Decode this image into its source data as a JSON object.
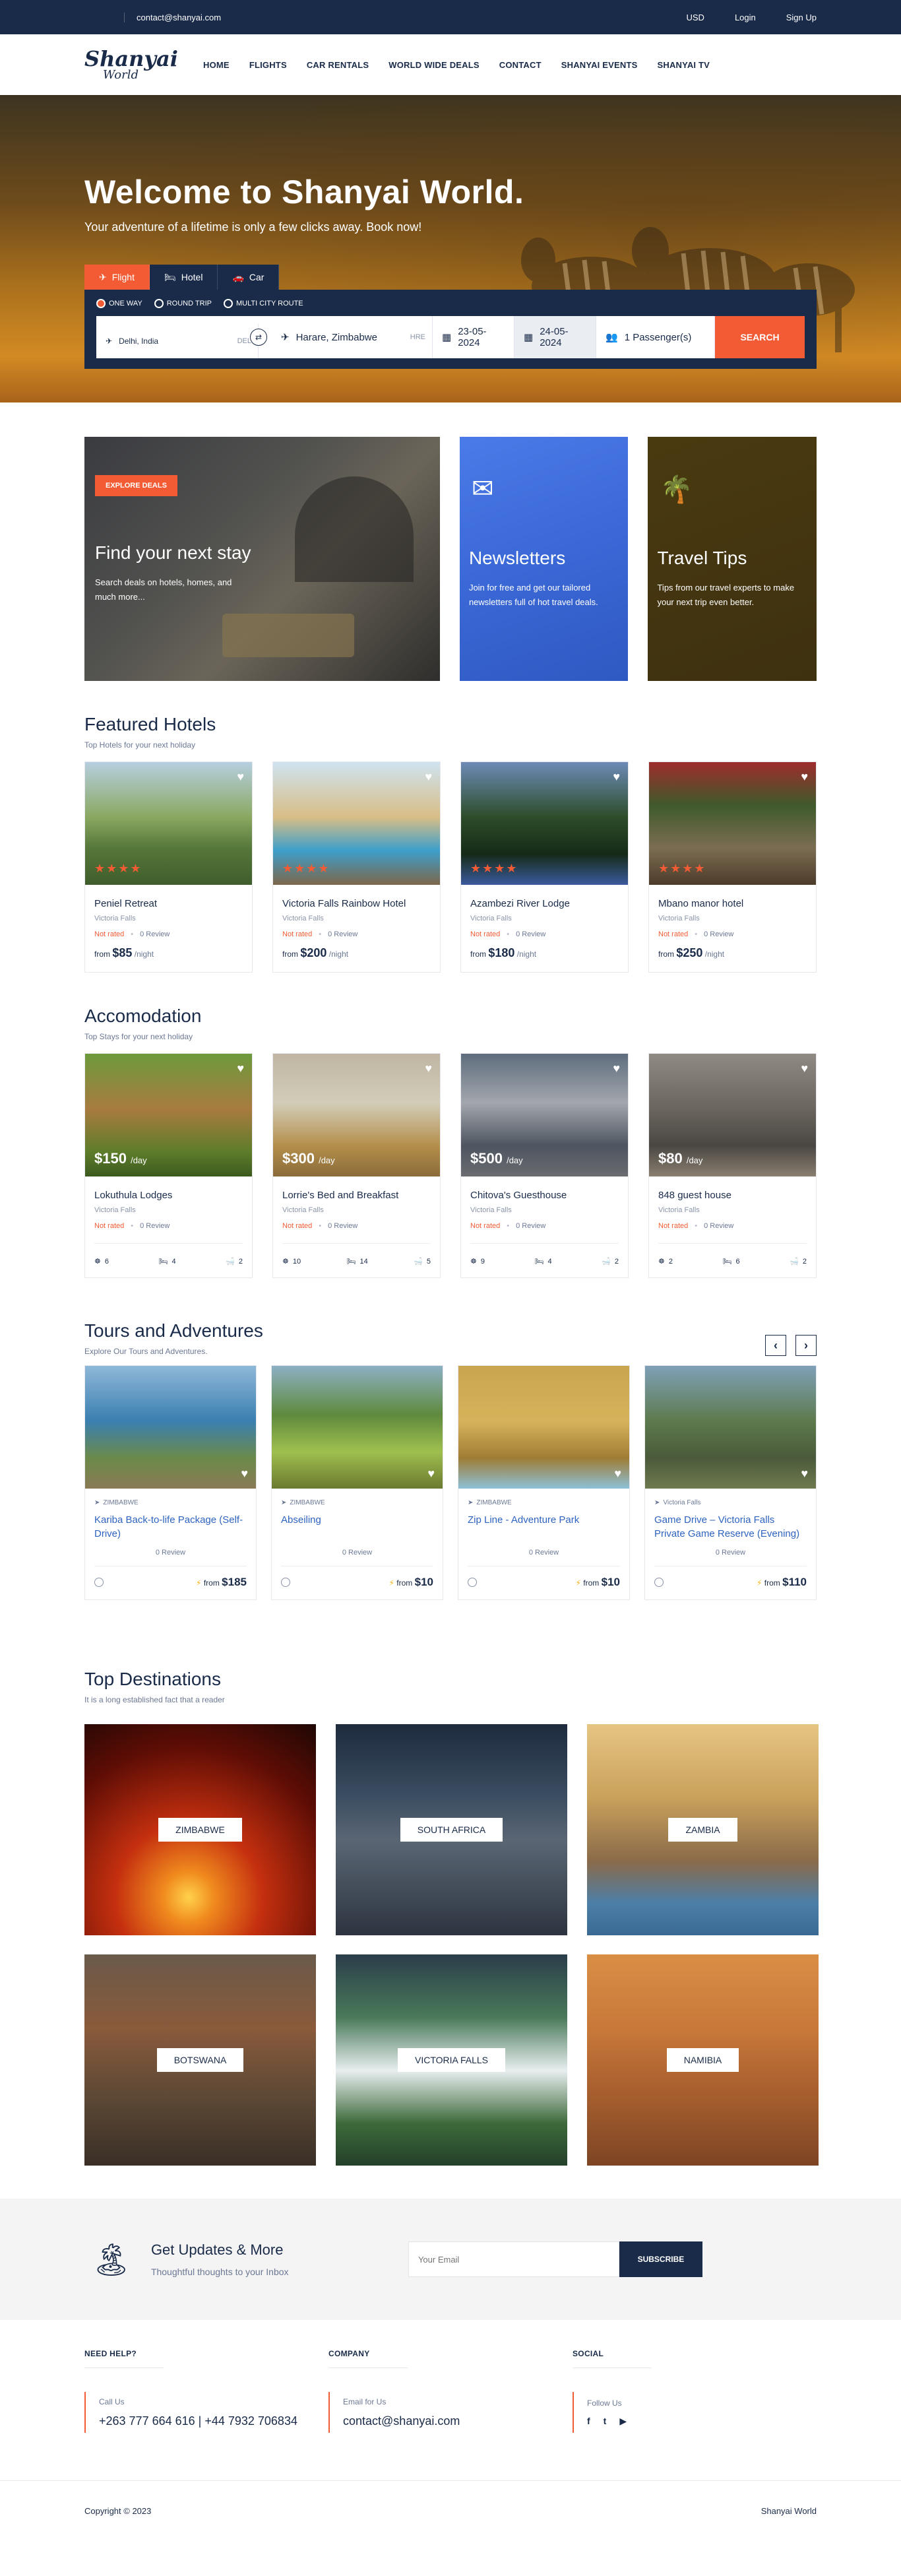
{
  "topbar": {
    "email": "contact@shanyai.com",
    "currency": "USD",
    "login": "Login",
    "signup": "Sign Up"
  },
  "brand": {
    "line1": "Shanyai",
    "line2": "World"
  },
  "nav": [
    "HOME",
    "FLIGHTS",
    "CAR RENTALS",
    "WORLD WIDE DEALS",
    "CONTACT",
    "SHANYAI EVENTS",
    "SHANYAI TV"
  ],
  "hero": {
    "title": "Welcome to Shanyai World.",
    "subtitle": "Your adventure of a lifetime is only a few clicks away. Book now!",
    "tabs": [
      "Flight",
      "Hotel",
      "Car"
    ],
    "trip_types": [
      "ONE WAY",
      "ROUND TRIP",
      "MULTI CITY ROUTE"
    ],
    "from": {
      "value": "Delhi, India",
      "code": "DEL"
    },
    "to": {
      "value": "Harare, Zimbabwe",
      "code": "HRE"
    },
    "depart": "23-05-2024",
    "return": "24-05-2024",
    "passengers": "1 Passenger(s)",
    "search_label": "SEARCH"
  },
  "promo": {
    "stay": {
      "badge": "EXPLORE DEALS",
      "title": "Find your next stay",
      "text": "Search deals on hotels, homes, and much more..."
    },
    "news": {
      "title": "Newsletters",
      "text": "Join for free and get our tailored newsletters full of hot travel deals."
    },
    "tips": {
      "title": "Travel Tips",
      "text": "Tips from our travel experts to make your next trip even better."
    }
  },
  "featured": {
    "title": "Featured Hotels",
    "tagline": "Top Hotels for your next holiday",
    "hotels": [
      {
        "name": "Peniel Retreat",
        "loc": "Victoria Falls",
        "rated": "Not rated",
        "reviews": "0 Review",
        "from": "from",
        "price": "$85",
        "unit": "/night",
        "stars": "★★★★"
      },
      {
        "name": "Victoria Falls Rainbow Hotel",
        "loc": "Victoria Falls",
        "rated": "Not rated",
        "reviews": "0 Review",
        "from": "from",
        "price": "$200",
        "unit": "/night",
        "stars": "★★★★"
      },
      {
        "name": "Azambezi River Lodge",
        "loc": "Victoria Falls",
        "rated": "Not rated",
        "reviews": "0 Review",
        "from": "from",
        "price": "$180",
        "unit": "/night",
        "stars": "★★★★"
      },
      {
        "name": "Mbano manor hotel",
        "loc": "Victoria Falls",
        "rated": "Not rated",
        "reviews": "0 Review",
        "from": "from",
        "price": "$250",
        "unit": "/night",
        "stars": "★★★★"
      }
    ]
  },
  "accommodation": {
    "title": "Accomodation",
    "tagline": "Top Stays for your next holiday",
    "items": [
      {
        "price": "$150",
        "unit": "/day",
        "name": "Lokuthula Lodges",
        "loc": "Victoria Falls",
        "rated": "Not rated",
        "reviews": "0 Review",
        "guests": "6",
        "beds": "4",
        "baths": "2"
      },
      {
        "price": "$300",
        "unit": "/day",
        "name": "Lorrie's Bed and Breakfast",
        "loc": "Victoria Falls",
        "rated": "Not rated",
        "reviews": "0 Review",
        "guests": "10",
        "beds": "14",
        "baths": "5"
      },
      {
        "price": "$500",
        "unit": "/day",
        "name": "Chitova's Guesthouse",
        "loc": "Victoria Falls",
        "rated": "Not rated",
        "reviews": "0 Review",
        "guests": "9",
        "beds": "4",
        "baths": "2"
      },
      {
        "price": "$80",
        "unit": "/day",
        "name": "848 guest house",
        "loc": "Victoria Falls",
        "rated": "Not rated",
        "reviews": "0 Review",
        "guests": "2",
        "beds": "6",
        "baths": "2"
      }
    ]
  },
  "tours": {
    "title": "Tours and Adventures",
    "tagline": "Explore Our Tours and Adventures.",
    "items": [
      {
        "country": "ZIMBABWE",
        "name": "Kariba Back-to-life Package (Self-Drive)",
        "reviews": "0 Review",
        "from": "from",
        "price": "$185"
      },
      {
        "country": "ZIMBABWE",
        "name": "Abseiling",
        "reviews": "0 Review",
        "from": "from",
        "price": "$10"
      },
      {
        "country": "ZIMBABWE",
        "name": "Zip Line - Adventure Park",
        "reviews": "0 Review",
        "from": "from",
        "price": "$10"
      },
      {
        "country": "Victoria Falls",
        "name": "Game Drive – Victoria Falls Private Game Reserve (Evening)",
        "reviews": "0 Review",
        "from": "from",
        "price": "$110"
      }
    ]
  },
  "destinations": {
    "title": "Top Destinations",
    "tagline": "It is a long established fact that a reader",
    "items": [
      "ZIMBABWE",
      "SOUTH AFRICA",
      "ZAMBIA",
      "BOTSWANA",
      "VICTORIA FALLS",
      "NAMIBIA"
    ]
  },
  "newsletter": {
    "title": "Get Updates & More",
    "subtitle": "Thoughtful thoughts to your Inbox",
    "placeholder": "Your Email",
    "button": "SUBSCRIBE"
  },
  "footer": {
    "help": {
      "heading": "NEED HELP?",
      "label": "Call Us",
      "value": "+263 777 664 616 | +44 7932 706834"
    },
    "company": {
      "heading": "COMPANY",
      "label": "Email for Us",
      "value": "contact@shanyai.com"
    },
    "social": {
      "heading": "SOCIAL",
      "label": "Follow Us",
      "icons": [
        "f",
        "t",
        "▶"
      ]
    },
    "copyright": "Copyright © 2023",
    "brand": "Shanyai World"
  },
  "colors": {
    "navy": "#1a2b49",
    "accent": "#f25b33",
    "link": "#2e63c0"
  }
}
